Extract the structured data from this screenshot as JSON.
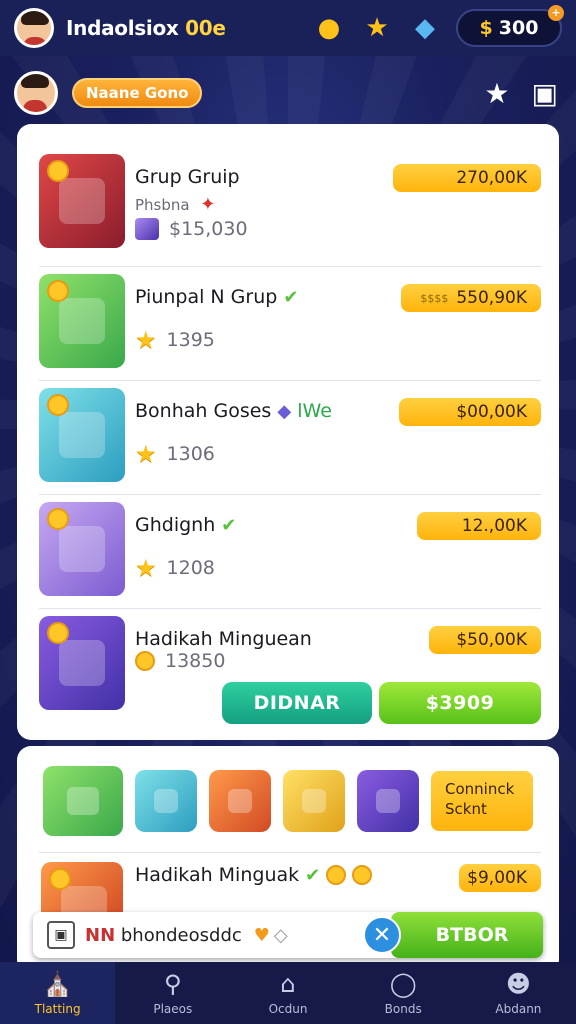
{
  "header": {
    "title_main": "Indaolsiox",
    "title_accent": "00e",
    "coins": "300",
    "currency_symbol": "$",
    "add_symbol": "+"
  },
  "profile": {
    "name_pill": "Naane Gono"
  },
  "items": [
    {
      "title": "Grup Gruip",
      "subtitle": "Phsbna",
      "meta_value": "$15,030",
      "price": "270,00K",
      "meta_icon": "gem-icon"
    },
    {
      "title": "Piunpal N Grup",
      "subtitle": "",
      "meta_value": "1395",
      "price": "550,90K",
      "price_prefix": "$$$$",
      "meta_icon": "star-icon"
    },
    {
      "title": "Bonhah Goses",
      "title_tag": "lWe",
      "subtitle": "",
      "meta_value": "1306",
      "price": "$00,00K",
      "meta_icon": "star-icon"
    },
    {
      "title": "Ghdignh",
      "subtitle": "",
      "meta_value": "1208",
      "price": "12.,00K",
      "meta_icon": "star-icon"
    },
    {
      "title": "Hadikah Minguean",
      "subtitle": "",
      "meta_value": "13850",
      "price": "$50,00K",
      "meta_icon": "coin-icon"
    }
  ],
  "actions": {
    "teal_button": "DIDNAR",
    "green_button": "$3909"
  },
  "second_card": {
    "cta_text": "Conninck Scknt",
    "item_title": "Hadikah Minguak",
    "item_price": "$9,00K"
  },
  "toast": {
    "prefix": "NN",
    "text": "bhondeosddc",
    "button": "BTBOR",
    "close_symbol": "✕"
  },
  "nav": [
    {
      "label": "Tlatting",
      "icon": "store-icon"
    },
    {
      "label": "Plaeos",
      "icon": "search-icon"
    },
    {
      "label": "Ocdun",
      "icon": "home-icon"
    },
    {
      "label": "Bonds",
      "icon": "badge-icon"
    },
    {
      "label": "Abdann",
      "icon": "profile-icon"
    }
  ],
  "colors": {
    "background": "#1b2160",
    "accent_yellow": "#ffc627",
    "accent_green": "#58c21a",
    "accent_teal": "#14a082",
    "price_badge": "#ffd040"
  }
}
